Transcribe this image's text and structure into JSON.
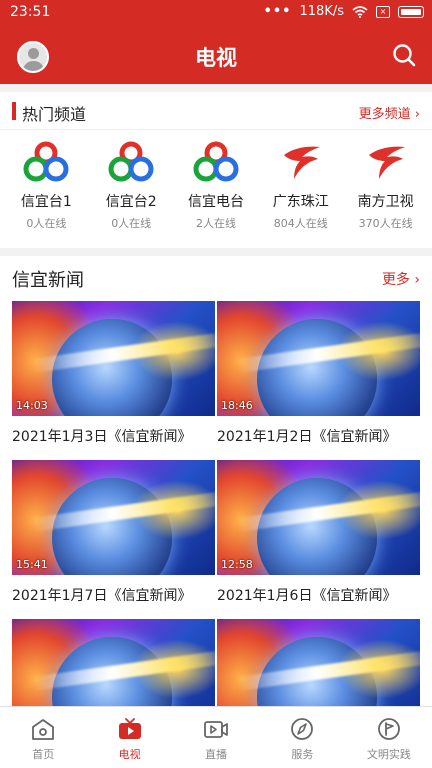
{
  "status": {
    "time": "23:51",
    "speed": "118K/s"
  },
  "header": {
    "title": "电视"
  },
  "hot_channels": {
    "title": "热门频道",
    "more": "更多频道",
    "items": [
      {
        "name": "信宜台1",
        "online": "0人在线",
        "logo": "xinyi-logo"
      },
      {
        "name": "信宜台2",
        "online": "0人在线",
        "logo": "xinyi-logo"
      },
      {
        "name": "信宜电台",
        "online": "2人在线",
        "logo": "xinyi-logo"
      },
      {
        "name": "广东珠江",
        "online": "804人在线",
        "logo": "guangdong-logo"
      },
      {
        "name": "南方卫视",
        "online": "370人在线",
        "logo": "guangdong-logo"
      }
    ]
  },
  "news": {
    "title": "信宜新闻",
    "more": "更多",
    "items": [
      {
        "duration": "14:03",
        "caption": "2021年1月3日《信宜新闻》"
      },
      {
        "duration": "18:46",
        "caption": "2021年1月2日《信宜新闻》"
      },
      {
        "duration": "15:41",
        "caption": "2021年1月7日《信宜新闻》"
      },
      {
        "duration": "12:58",
        "caption": "2021年1月6日《信宜新闻》"
      },
      {
        "duration": "",
        "caption": ""
      },
      {
        "duration": "",
        "caption": ""
      }
    ]
  },
  "tabs": [
    {
      "label": "首页",
      "icon": "home-icon",
      "active": false
    },
    {
      "label": "电视",
      "icon": "tv-icon",
      "active": true
    },
    {
      "label": "直播",
      "icon": "live-icon",
      "active": false
    },
    {
      "label": "服务",
      "icon": "compass-icon",
      "active": false
    },
    {
      "label": "文明实践",
      "icon": "flag-icon",
      "active": false
    }
  ],
  "colors": {
    "brand": "#d52b25",
    "text": "#222222",
    "muted": "#888888"
  }
}
